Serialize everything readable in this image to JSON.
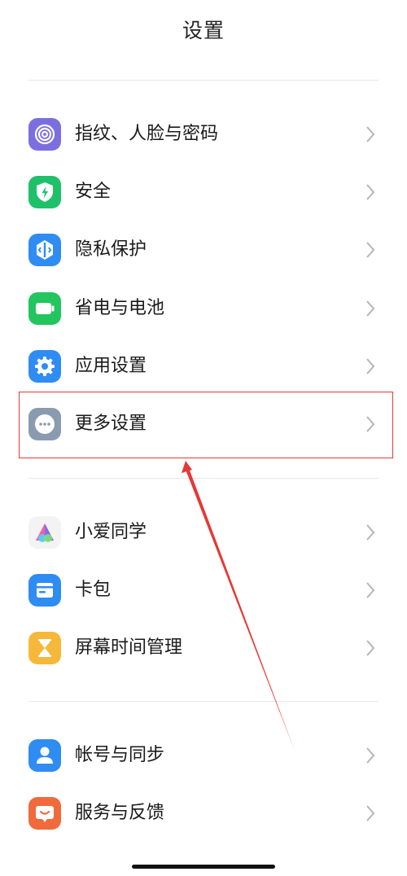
{
  "header": {
    "title": "设置"
  },
  "colors": {
    "fingerprint": "#7b6fe0",
    "security": "#1fc06a",
    "privacy": "#2f8cf2",
    "battery": "#22c55e",
    "apps": "#2f8cf2",
    "more": "#8a9bb0",
    "wallet": "#2f8cf2",
    "screen_time": "#f5b83a",
    "account": "#2f8cf2",
    "feedback": "#f06a3c",
    "highlight": "#e53935"
  },
  "groups": [
    {
      "items": [
        {
          "label": "指纹、人脸与密码",
          "icon": "fingerprint-icon"
        },
        {
          "label": "安全",
          "icon": "shield-lightning-icon"
        },
        {
          "label": "隐私保护",
          "icon": "privacy-icon"
        },
        {
          "label": "省电与电池",
          "icon": "battery-icon"
        },
        {
          "label": "应用设置",
          "icon": "gear-icon"
        },
        {
          "label": "更多设置",
          "icon": "more-dots-icon"
        }
      ]
    },
    {
      "items": [
        {
          "label": "小爱同学",
          "icon": "xiaoai-icon"
        },
        {
          "label": "卡包",
          "icon": "wallet-icon"
        },
        {
          "label": "屏幕时间管理",
          "icon": "hourglass-icon"
        }
      ]
    },
    {
      "items": [
        {
          "label": "帐号与同步",
          "icon": "user-icon"
        },
        {
          "label": "服务与反馈",
          "icon": "feedback-icon"
        }
      ]
    }
  ]
}
